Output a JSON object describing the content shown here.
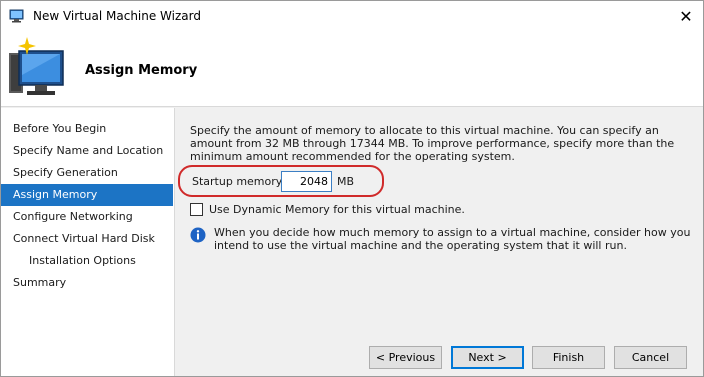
{
  "window": {
    "title": "New Virtual Machine Wizard",
    "close_glyph": "✕"
  },
  "header": {
    "title": "Assign Memory",
    "icon": "virtual-machine-computer-icon"
  },
  "sidebar": {
    "items": [
      {
        "label": "Before You Begin",
        "active": false,
        "sub": false
      },
      {
        "label": "Specify Name and Location",
        "active": false,
        "sub": false
      },
      {
        "label": "Specify Generation",
        "active": false,
        "sub": false
      },
      {
        "label": "Assign Memory",
        "active": true,
        "sub": false
      },
      {
        "label": "Configure Networking",
        "active": false,
        "sub": false
      },
      {
        "label": "Connect Virtual Hard Disk",
        "active": false,
        "sub": false
      },
      {
        "label": "Installation Options",
        "active": false,
        "sub": true
      },
      {
        "label": "Summary",
        "active": false,
        "sub": false
      }
    ]
  },
  "main": {
    "description": "Specify the amount of memory to allocate to this virtual machine. You can specify an amount from 32 MB through 17344 MB. To improve performance, specify more than the minimum amount recommended for the operating system.",
    "startup_memory": {
      "label": "Startup memory:",
      "value": "2048",
      "unit": "MB"
    },
    "dynamic_memory": {
      "label": "Use Dynamic Memory for this virtual machine.",
      "checked": false
    },
    "info": {
      "icon": "info-icon",
      "text": "When you decide how much memory to assign to a virtual machine, consider how you intend to use the virtual machine and the operating system that it will run."
    }
  },
  "footer": {
    "previous_label": "< Previous",
    "next_label": "Next >",
    "finish_label": "Finish",
    "cancel_label": "Cancel"
  },
  "colors": {
    "accent": "#1c74c5",
    "highlight_ring": "#d02a2a",
    "background": "#f0f0f0"
  }
}
